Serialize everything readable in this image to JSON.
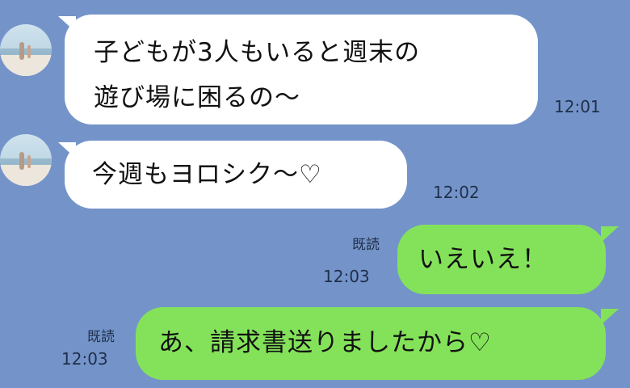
{
  "messages": [
    {
      "side": "left",
      "lines": [
        "子どもが3人もいると週末の",
        "遊び場に困るの〜"
      ],
      "time": "12:01"
    },
    {
      "side": "left",
      "lines": [
        "今週もヨロシク〜♡"
      ],
      "time": "12:02"
    },
    {
      "side": "right",
      "lines": [
        "いえいえ！"
      ],
      "time": "12:03",
      "read": "既読"
    },
    {
      "side": "right",
      "lines": [
        "あ、請求書送りましたから♡"
      ],
      "time": "12:03",
      "read": "既読"
    }
  ],
  "colors": {
    "background": "#7494c9",
    "incoming": "#ffffff",
    "outgoing": "#84e25a"
  }
}
